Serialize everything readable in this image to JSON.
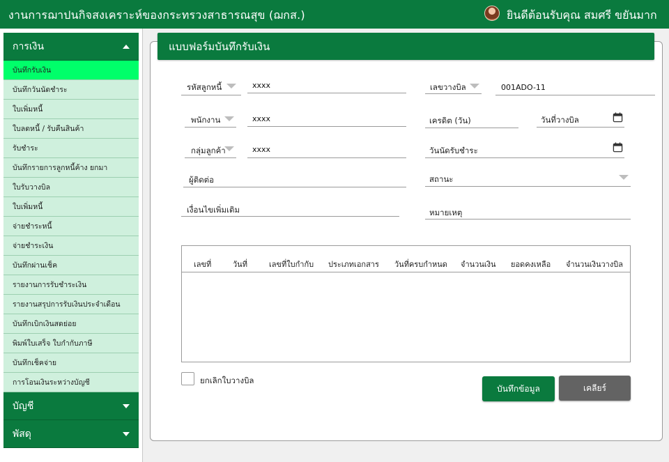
{
  "header": {
    "title": "งานการฌาปนกิจสงเคราะห์ของกระทรวงสาธารณสุข (ฌกส.)",
    "welcome": "ยินดีต้อนรับคุณ  สมศรี ขยันมาก"
  },
  "sidebar": {
    "finance_label": "การเงิน",
    "finance_items": [
      "บันทึกรับเงิน",
      "บันทึกวันนัดชำระ",
      "ใบเพิ่มหนี้",
      "ใบลดหนี้ / รับคืนสินค้า",
      "รับชำระ",
      "บันทึกรายการลูกหนี้ค้าง ยกมา",
      "ใบรับวางบิล",
      "ใบเพิ่มหนี้",
      "จ่ายชำระหนี้",
      "จ่ายชำระเงิน",
      "บันทึกผ่านเช็ค",
      "รายงานการรับชำระเงิน",
      "รายงานสรุปการรับเงินประจำเดือน",
      "บันทึกเบิกเงินสดย่อย",
      "พิมพ์ใบเสร็จ ใบกำกับภาษี",
      "บันทึกเช็คจ่าย",
      "การโอนเงินระหว่างบัญชี"
    ],
    "account_label": "บัญชี",
    "supplies_label": "พัสดุ"
  },
  "form": {
    "heading": "แบบฟอร์มบันทึกรับเงิน",
    "customer_code_label": "รหัสลูกหนี้",
    "customer_code_value": "xxxx",
    "bill_no_label": "เลขวางบิล",
    "bill_no_value": "001ADO-11",
    "employee_label": "พนักงาน",
    "employee_value": "xxxx",
    "credit_label": "เครดิต (วัน)",
    "bill_date_label": "วันที่วางบิล",
    "customer_group_label": "กลุ่มลูกค้า",
    "customer_group_value": "xxxx",
    "payment_date_label": "วันนัดรับชำระ",
    "contact_label": "ผู้ติดต่อ",
    "status_label": "สถานะ",
    "condition_label": "เงื่อนไขเพิ่มเติม",
    "note_label": "หมายเหตุ"
  },
  "table": {
    "columns": [
      "เลขที่",
      "วันที่",
      "เลขที่ใบกำกับ",
      "ประเภทเอกสาร",
      "วันที่ครบกำหนด",
      "จำนวนเงิน",
      "ยอดคงเหลือ",
      "จำนวนเงินวางบิล"
    ]
  },
  "footer": {
    "cancel_bill_label": "ยกเลิกใบวางบิล",
    "save_label": "บันทึกข้อมูล",
    "clear_label": "เคลียร์"
  },
  "colors": {
    "brand_green": "#0a7a3e",
    "active_item": "#00ff6a",
    "submenu_bg": "#cff0dd",
    "clear_button": "#636363"
  }
}
